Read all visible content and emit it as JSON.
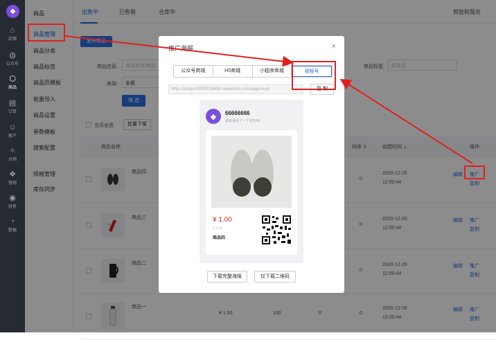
{
  "sidebar_rail": {
    "items": [
      {
        "label": "店铺",
        "icon": "home-icon"
      },
      {
        "label": "公众号",
        "icon": "wechat-icon"
      },
      {
        "label": "商品",
        "icon": "box-icon"
      },
      {
        "label": "订单",
        "icon": "document-icon"
      },
      {
        "label": "客户",
        "icon": "user-icon"
      },
      {
        "label": "分销",
        "icon": "share-icon"
      },
      {
        "label": "营销",
        "icon": "gift-icon"
      },
      {
        "label": "财务",
        "icon": "coin-icon"
      },
      {
        "label": "数据",
        "icon": "chart-icon"
      }
    ]
  },
  "submenu": {
    "category": "商品",
    "items": [
      "商品管理",
      "商品分类",
      "商品标签",
      "商品页模板",
      "批量导入",
      "商品设置",
      "参数模板",
      "搜索配置",
      "规格管理",
      "库存同步"
    ]
  },
  "topnav": {
    "tabs": [
      "出售中",
      "已售罄",
      "仓库中"
    ],
    "help": "帮助和服务"
  },
  "toolbar": {
    "publish": "发布商品",
    "info_label": "商品信息:",
    "info_placeholder": "商品名称/商品",
    "source_label": "来源:",
    "source_value": "全部",
    "tag_label": "商品标签:",
    "tag_placeholder": "请多选",
    "filter": "筛 选",
    "select_all": "当页全选",
    "bulk_off": "批量下架"
  },
  "table": {
    "headers": [
      "商品名称",
      "排序 ⇕",
      "创建时间 ⇣",
      "操作"
    ],
    "rows": [
      {
        "name": "商品四",
        "price": "",
        "stock": "",
        "sales": "",
        "sort": "0",
        "date": "2020-12-26",
        "time": "12:00:44",
        "act1": "编辑",
        "act2": "推广",
        "act3": "复制"
      },
      {
        "name": "商品三",
        "price": "",
        "stock": "",
        "sales": "",
        "sort": "0",
        "date": "2020-12-26",
        "time": "12:00:44",
        "act1": "编辑",
        "act2": "推广",
        "act3": "复制"
      },
      {
        "name": "商品二",
        "price": "",
        "stock": "",
        "sales": "",
        "sort": "0",
        "date": "2020-12-26",
        "time": "12:00:44",
        "act1": "编辑",
        "act2": "推广",
        "act3": "复制"
      },
      {
        "name": "商品一",
        "price": "¥ 1.00",
        "stock": "100",
        "sales": "0",
        "sort": "0",
        "date": "2020-12-26",
        "time": "12:00:44",
        "act1": "编辑",
        "act2": "推广",
        "act3": "复制"
      }
    ]
  },
  "modal": {
    "title": "推广海报",
    "close": "×",
    "tabs": [
      "公众号商城",
      "H5商城",
      "小程序商城",
      "视频号"
    ],
    "url": "https://shop100000016698.xiaokeduo.cn/#/pagvshop/",
    "copy": "复 制",
    "poster": {
      "shop_name": "66666666",
      "subtitle": "搞错事情了一个好东西",
      "price": "¥ 1.00",
      "price_sub": "¥ 1.00",
      "product_name": "商品四"
    },
    "download_poster": "下载完整海报",
    "download_qr": "仅下载二维码"
  },
  "colors": {
    "accent": "#2e6de0",
    "annotation": "#e02020",
    "price": "#e12a2a",
    "brand": "#7b4fe0"
  }
}
